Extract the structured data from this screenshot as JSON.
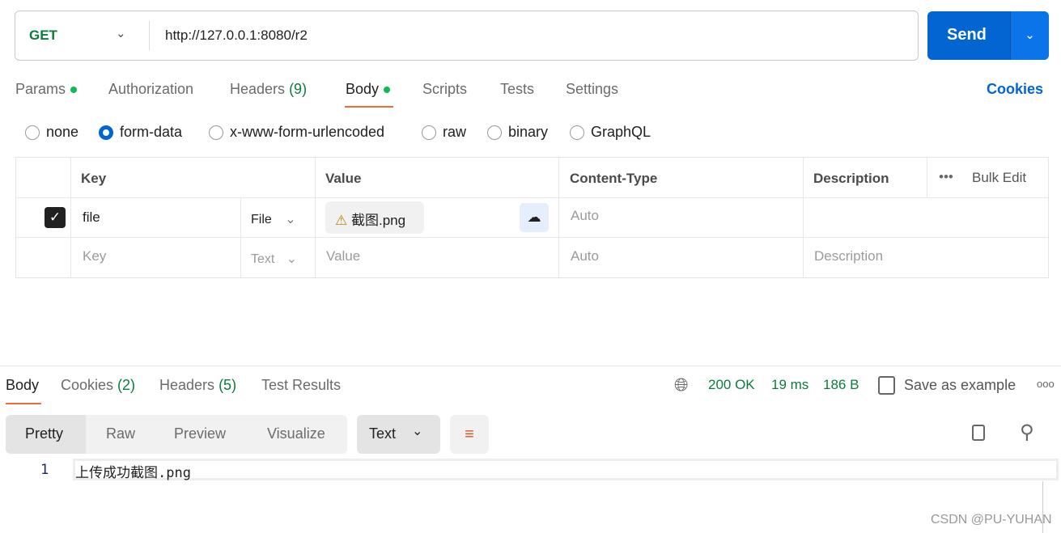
{
  "request": {
    "method": "GET",
    "url": "http://127.0.0.1:8080/r2",
    "send_label": "Send"
  },
  "tabs": [
    {
      "label": "Params"
    },
    {
      "label": "Authorization"
    },
    {
      "label": "Headers",
      "count": "(9)"
    },
    {
      "label": "Body"
    },
    {
      "label": "Scripts"
    },
    {
      "label": "Tests"
    },
    {
      "label": "Settings"
    }
  ],
  "cookies_link": "Cookies",
  "body_types": [
    "none",
    "form-data",
    "x-www-form-urlencoded",
    "raw",
    "binary",
    "GraphQL"
  ],
  "selected_body_type": "form-data",
  "table": {
    "headers": {
      "key": "Key",
      "value": "Value",
      "content_type": "Content-Type",
      "description": "Description",
      "bulk_edit": "Bulk Edit"
    },
    "rows": [
      {
        "checked": true,
        "key": "file",
        "type": "File",
        "value": "截图.png",
        "content_type": "Auto"
      }
    ],
    "placeholder_row": {
      "key": "Key",
      "type": "Text",
      "value": "Value",
      "content_type": "Auto",
      "description": "Description"
    }
  },
  "response": {
    "tabs": [
      {
        "label": "Body"
      },
      {
        "label": "Cookies",
        "count": "(2)"
      },
      {
        "label": "Headers",
        "count": "(5)"
      },
      {
        "label": "Test Results"
      }
    ],
    "status": "200 OK",
    "time": "19 ms",
    "size": "186 B",
    "save_label": "Save as example",
    "view_modes": [
      "Pretty",
      "Raw",
      "Preview",
      "Visualize"
    ],
    "format": "Text",
    "lines": [
      {
        "num": "1",
        "text": "上传成功截图.png"
      }
    ]
  },
  "watermark": "CSDN @PU-YUHAN",
  "colors": {
    "accent": "#0265d2",
    "status_green": "#0a7d3a",
    "tab_underline": "#f26b3a"
  }
}
